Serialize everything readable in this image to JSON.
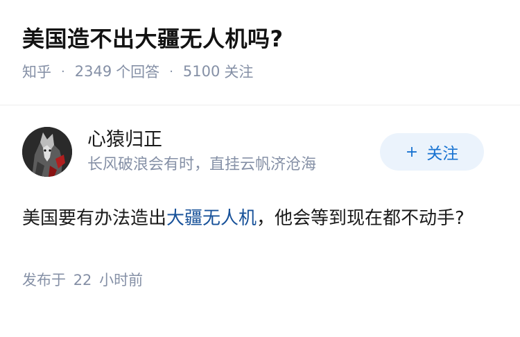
{
  "question": {
    "title": "美国造不出大疆无人机吗?",
    "source": "知乎",
    "answer_count": "2349",
    "answer_label": "个回答",
    "follower_count": "5100",
    "follower_label": "关注"
  },
  "answer": {
    "author_name": "心猿归正",
    "author_bio": "长风破浪会有时，直挂云帆济沧海",
    "follow_plus": "+",
    "follow_label": "关注",
    "content_before": "美国要有办法造出",
    "content_link": "大疆无人机",
    "content_after": "，他会等到现在都不动手?",
    "time_prefix": "发布于",
    "time_value": "22",
    "time_suffix": "小时前"
  },
  "colors": {
    "link": "#175199",
    "follow_text": "#1772d1",
    "follow_bg": "#ebf3fc",
    "meta_gray": "#8590a6"
  },
  "icons": {
    "avatar": "wolf-warrior-avatar"
  }
}
